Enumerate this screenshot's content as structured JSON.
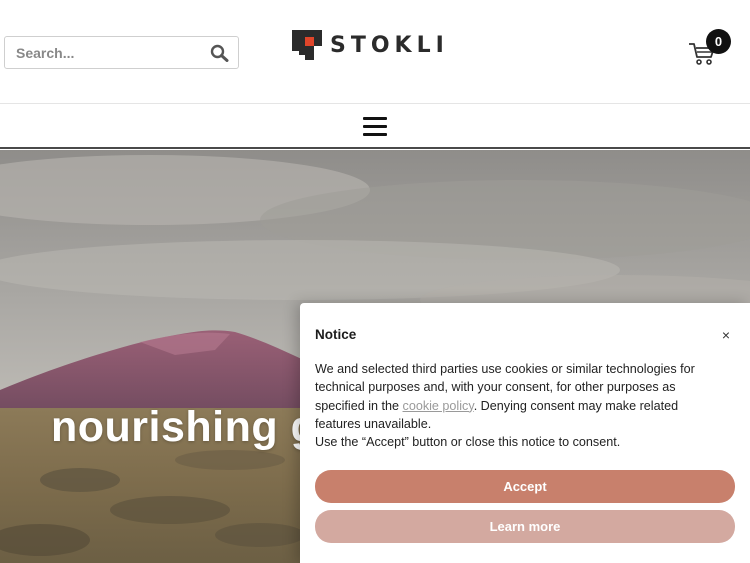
{
  "header": {
    "search": {
      "placeholder": "Search..."
    },
    "logo_text": "STOKLI",
    "cart_count": "0"
  },
  "hero": {
    "title": "nourishing g"
  },
  "notice": {
    "title": "Notice",
    "close_label": "×",
    "text_before_link": "We and selected third parties use cookies or similar technologies for technical purposes and, with your consent, for other purposes as specified in the ",
    "link_text": "cookie policy",
    "text_after_link": ". Denying consent may make related features unavailable.",
    "text_line2": "Use the “Accept” button or close this notice to consent.",
    "accept_label": "Accept",
    "learn_more_label": "Learn more"
  },
  "colors": {
    "accept": "#c8806c",
    "learn_more": "#d3a9a0",
    "logo_accent": "#e0452a"
  }
}
